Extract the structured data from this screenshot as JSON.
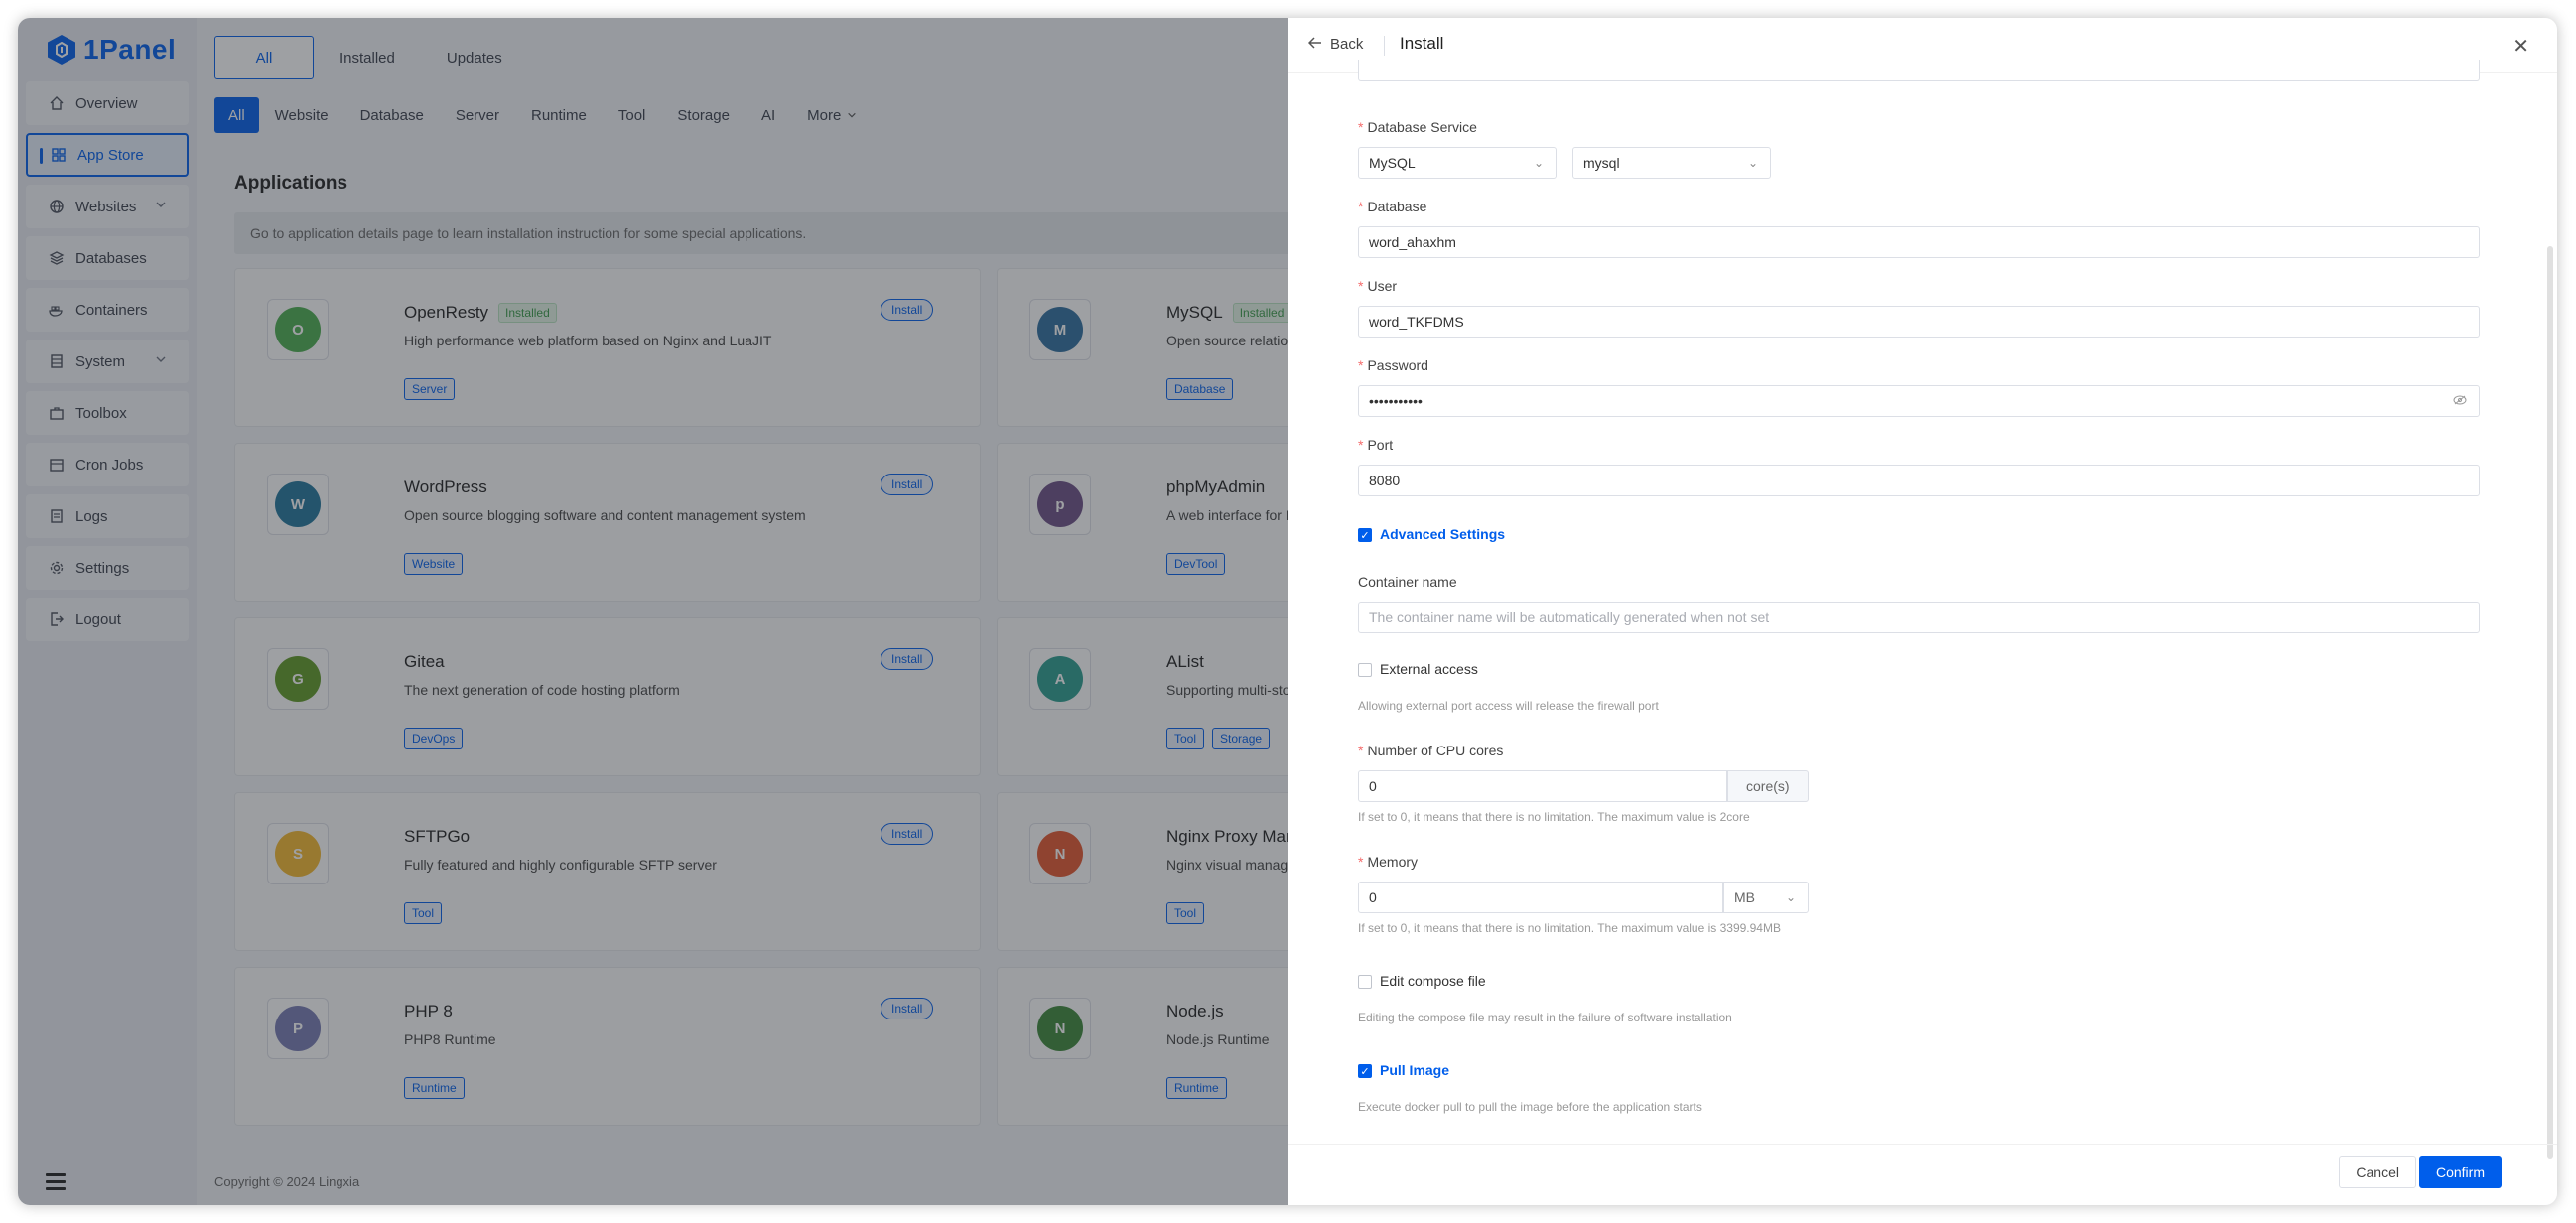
{
  "brand": {
    "name": "1Panel"
  },
  "sidebar": {
    "items": [
      {
        "label": "Overview",
        "icon": "home-icon"
      },
      {
        "label": "App Store",
        "icon": "grid-icon",
        "active": true
      },
      {
        "label": "Websites",
        "icon": "globe-icon",
        "has_children": true
      },
      {
        "label": "Databases",
        "icon": "layers-icon"
      },
      {
        "label": "Containers",
        "icon": "container-icon"
      },
      {
        "label": "System",
        "icon": "server-icon",
        "has_children": true
      },
      {
        "label": "Toolbox",
        "icon": "toolbox-icon"
      },
      {
        "label": "Cron Jobs",
        "icon": "calendar-icon"
      },
      {
        "label": "Logs",
        "icon": "log-icon"
      },
      {
        "label": "Settings",
        "icon": "gear-icon"
      },
      {
        "label": "Logout",
        "icon": "logout-icon"
      }
    ]
  },
  "main": {
    "top_tabs": [
      "All",
      "Installed",
      "Updates"
    ],
    "category_tabs": [
      "All",
      "Website",
      "Database",
      "Server",
      "Runtime",
      "Tool",
      "Storage",
      "AI",
      "More"
    ],
    "section_title": "Applications",
    "notice": "Go to application details page to learn installation instruction for some special applications.",
    "apps": [
      {
        "name": "OpenResty",
        "installed_label": "Installed",
        "desc": "High performance web platform based on Nginx and LuaJIT",
        "tags": [
          "Server"
        ],
        "action": "Install",
        "color": "#4bae4f"
      },
      {
        "name": "MySQL",
        "installed_label": "Installed",
        "desc": "Open source relational database",
        "tags": [
          "Database"
        ],
        "action": "",
        "color": "#2f6e9e"
      },
      {
        "name": "WordPress",
        "installed_label": "",
        "desc": "Open source blogging software and content management system",
        "tags": [
          "Website"
        ],
        "action": "Install",
        "color": "#21759b"
      },
      {
        "name": "phpMyAdmin",
        "installed_label": "",
        "desc": "A web interface for MySQL",
        "tags": [
          "DevTool"
        ],
        "action": "",
        "color": "#6c4f86"
      },
      {
        "name": "Gitea",
        "installed_label": "",
        "desc": "The next generation of code hosting platform",
        "tags": [
          "DevOps"
        ],
        "action": "Install",
        "color": "#609926"
      },
      {
        "name": "AList",
        "installed_label": "",
        "desc": "Supporting multi-storage file list",
        "tags": [
          "Tool",
          "Storage"
        ],
        "action": "",
        "color": "#2a9d8f"
      },
      {
        "name": "SFTPGo",
        "installed_label": "",
        "desc": "Fully featured and highly configurable SFTP server",
        "tags": [
          "Tool"
        ],
        "action": "Install",
        "color": "#f5b82e"
      },
      {
        "name": "Nginx Proxy Manager",
        "installed_label": "",
        "desc": "Nginx visual management",
        "tags": [
          "Tool"
        ],
        "action": "",
        "color": "#e4572e"
      },
      {
        "name": "PHP 8",
        "installed_label": "",
        "desc": "PHP8 Runtime",
        "tags": [
          "Runtime"
        ],
        "action": "Install",
        "color": "#777bb3"
      },
      {
        "name": "Node.js",
        "installed_label": "",
        "desc": "Node.js Runtime",
        "tags": [
          "Runtime"
        ],
        "action": "",
        "color": "#3c873a"
      }
    ],
    "footer": "Copyright © 2024 Lingxia"
  },
  "drawer": {
    "back_label": "Back",
    "title": "Install",
    "fields": {
      "db_service_label": "Database Service",
      "db_service_value": "MySQL",
      "db_instance_value": "mysql",
      "database_label": "Database",
      "database_value": "word_ahaxhm",
      "user_label": "User",
      "user_value": "word_TKFDMS",
      "password_label": "Password",
      "password_value": "•••••••••••",
      "port_label": "Port",
      "port_value": "8080",
      "advanced_label": "Advanced Settings",
      "container_name_label": "Container name",
      "container_name_placeholder": "The container name will be automatically generated when not set",
      "external_access_label": "External access",
      "external_access_help": "Allowing external port access will release the firewall port",
      "cpu_label": "Number of CPU cores",
      "cpu_value": "0",
      "cpu_unit": "core(s)",
      "cpu_help": "If set to 0, it means that there is no limitation. The maximum value is 2core",
      "memory_label": "Memory",
      "memory_value": "0",
      "memory_unit": "MB",
      "memory_help": "If set to 0, it means that there is no limitation. The maximum value is 3399.94MB",
      "compose_label": "Edit compose file",
      "compose_help": "Editing the compose file may result in the failure of software installation",
      "pull_label": "Pull Image",
      "pull_help": "Execute docker pull to pull the image before the application starts"
    },
    "cancel_label": "Cancel",
    "confirm_label": "Confirm"
  }
}
